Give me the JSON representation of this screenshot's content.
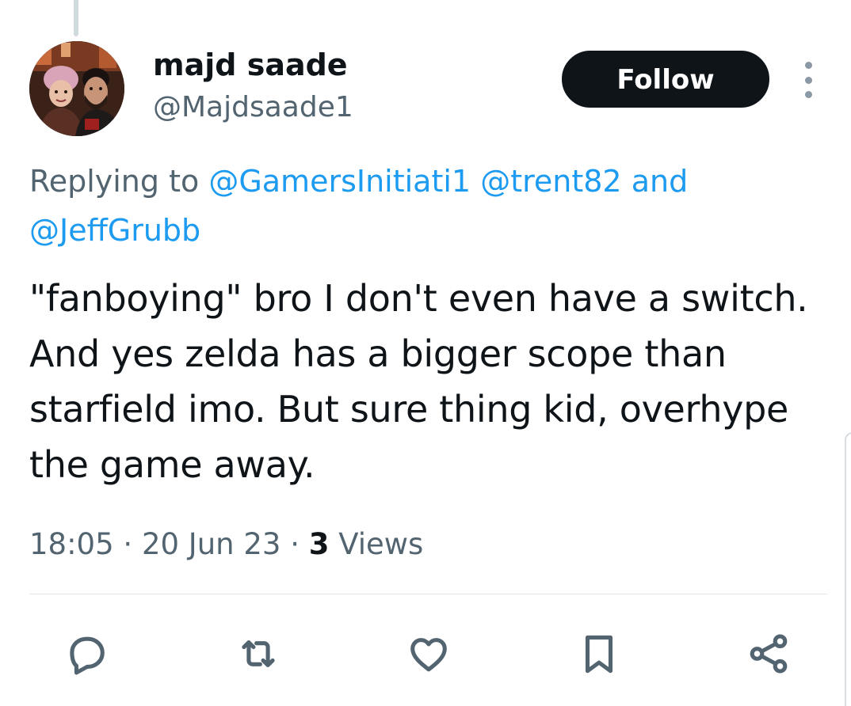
{
  "tweet": {
    "display_name": "majd saade",
    "handle": "@Majdsaade1",
    "follow_label": "Follow",
    "replying_to_label": "Replying to",
    "mentions": [
      "@GamersInitiati1",
      "@trent82",
      "@JeffGrubb"
    ],
    "mentions_joiner": "and",
    "text": "\"fanboying\" bro I don't even have a switch. And yes zelda has a bigger scope than starfield imo. But sure thing kid, overhype the game away.",
    "time": "18:05",
    "date": "20 Jun 23",
    "separator": "·",
    "views_count": "3",
    "views_label": "Views"
  },
  "icons": {
    "avatar": "avatar-photo",
    "more": "more-vertical-icon",
    "actions": [
      "reply-icon",
      "retweet-icon",
      "like-icon",
      "bookmark-icon",
      "share-icon"
    ]
  },
  "colors": {
    "text": "#0f1419",
    "secondary": "#536471",
    "link": "#1d9bf0",
    "button_bg": "#0f1419",
    "button_text": "#ffffff",
    "icon": "#536471",
    "divider": "#e1e6ea"
  }
}
